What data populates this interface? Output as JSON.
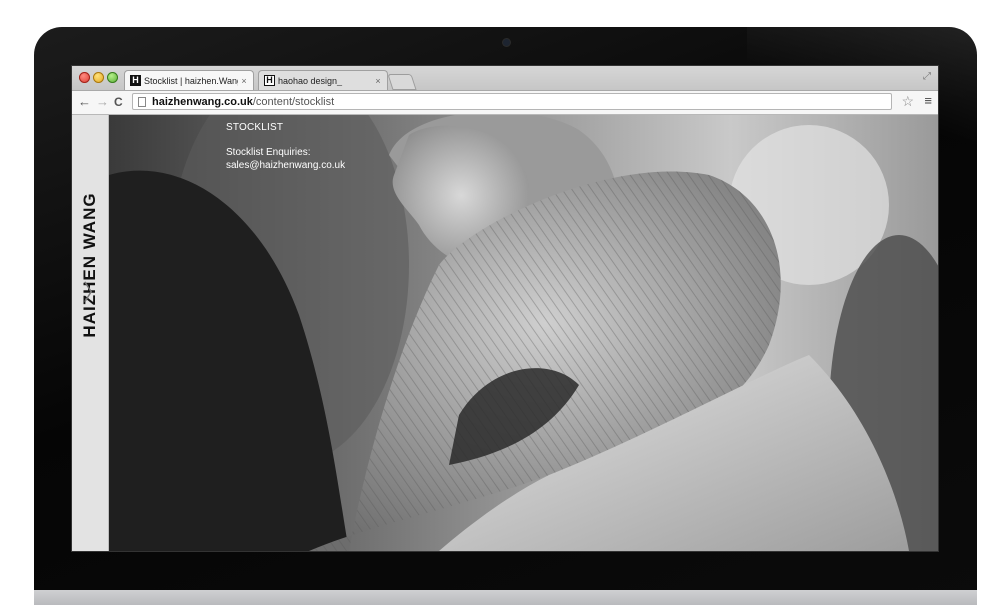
{
  "browser": {
    "tabs": [
      {
        "title": "Stocklist | haizhen.Wang",
        "favicon": "H",
        "close": "×"
      },
      {
        "title": "haohao design_",
        "favicon": "H",
        "close": "×"
      }
    ],
    "nav": {
      "back": "←",
      "forward": "→",
      "reload": "C"
    },
    "url": {
      "host": "haizhenwang.co.uk",
      "path": "/content/stocklist"
    },
    "star_icon": "☆",
    "menu_icon": "≡",
    "resize_icon": "⤢"
  },
  "site": {
    "brand": "HAIZHEN WANG",
    "chevron": "〉",
    "page_title": "STOCKLIST",
    "enquiries_label": "Stocklist Enquiries:",
    "email": "sales@haizhenwang.co.uk"
  },
  "colors": {
    "sidebar": "#e3e3e3",
    "text_on_photo": "#ffffff",
    "bezel": "#0b0b0b"
  }
}
